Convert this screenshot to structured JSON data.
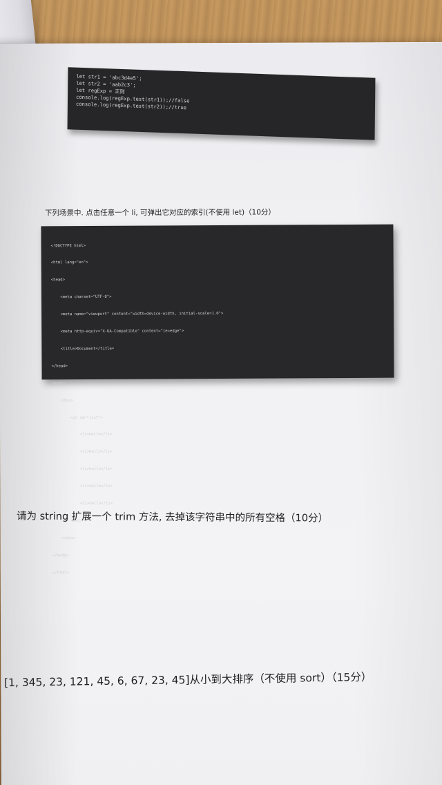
{
  "photo": {
    "description_icon": "exam-paper-photo",
    "code_block_1": {
      "lines": [
        "let str1 = 'abc3d4e5';",
        "let str2 = 'aab2c3';",
        "let regExp = 正则",
        "console.log(regExp.test(str1));//false",
        "console.log(regExp.test(str2));//true"
      ]
    },
    "question_1": "下列场景中. 点击任意一个 li, 可弹出它对应的索引(不使用 let)（10分）",
    "code_block_2": {
      "lines": [
        "<!DOCTYPE html>",
        "<html lang=\"en\">",
        "<head>",
        "    <meta charset=\"UTF-8\">",
        "    <meta name=\"viewport\" content=\"width=device-width, initial-scale=1.0\">",
        "    <meta http-equiv=\"X-UA-Compatible\" content=\"ie=edge\">",
        "    <title>Document</title>",
        "</head>",
        "<body>",
        "    <div>",
        "        <ul id=\"list\">",
        "            <li>hello</li>",
        "            <li>hello</li>",
        "            <li>hello</li>",
        "            <li>hello</li>",
        "            <li>hello</li>",
        "        </ul>",
        "    </div>",
        "</body>",
        "</html>"
      ]
    },
    "question_2": "请为 string 扩展一个 trim 方法, 去掉该字符串中的所有空格（10分）",
    "question_3": "[1, 345, 23, 121, 45, 6, 67, 23, 45]从小到大排序（不使用 sort）（15分）"
  }
}
